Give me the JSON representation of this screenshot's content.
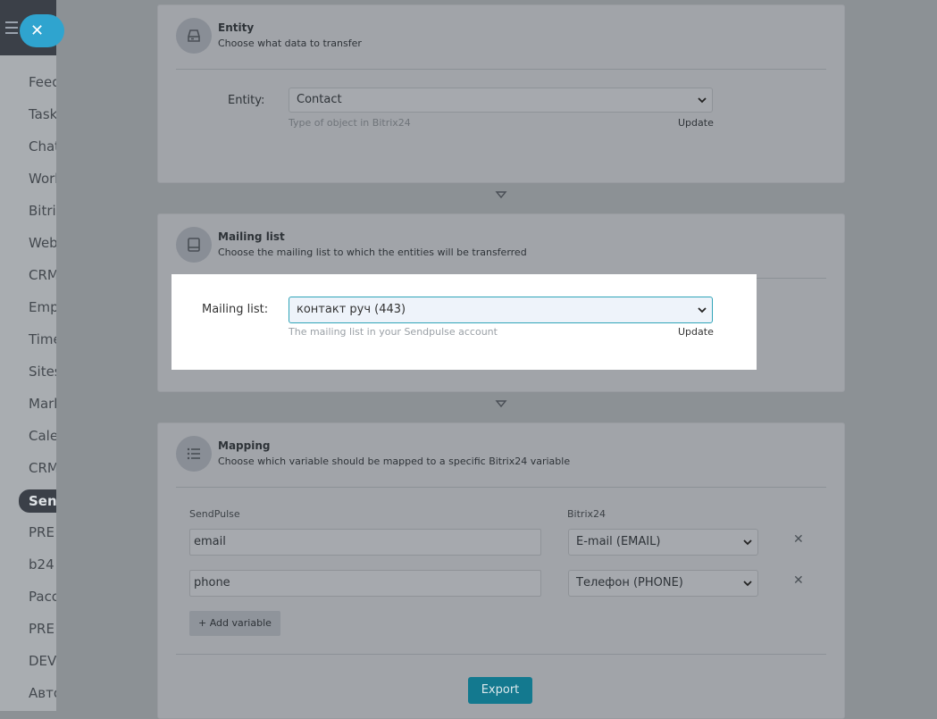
{
  "sidebar": {
    "items": [
      "Feed",
      "Tasks",
      "Chat",
      "Work",
      "Bitrix",
      "Web",
      "CRM",
      "Emp",
      "Time",
      "Sites",
      "Mark",
      "Cale",
      "CRM",
      "Send",
      "PRE",
      "b24",
      "Pacc",
      "PRE",
      "DEV",
      "Авто"
    ],
    "active_label": "Send"
  },
  "close_icon": "close-icon",
  "entity": {
    "title": "Entity",
    "subtitle": "Choose what data to transfer",
    "field_label": "Entity:",
    "value": "Contact",
    "hint": "Type of object in Bitrix24",
    "update": "Update"
  },
  "mailing": {
    "title": "Mailing list",
    "subtitle": "Choose the mailing list to which the entities will be transferred",
    "field_label": "Mailing list:",
    "value": "контакт руч (443)",
    "hint": "The mailing list in your Sendpulse account",
    "update": "Update"
  },
  "mapping": {
    "title": "Mapping",
    "subtitle": "Choose which variable should be mapped to a specific Bitrix24 variable",
    "col_left": "SendPulse",
    "col_right": "Bitrix24",
    "rows": [
      {
        "sendpulse": "email",
        "bitrix": "E-mail (EMAIL)"
      },
      {
        "sendpulse": "phone",
        "bitrix": "Телефон (PHONE)"
      }
    ],
    "add_variable": "Add variable",
    "export": "Export"
  },
  "colors": {
    "accent": "#2fa4cf",
    "export": "#13798f",
    "focus": "#2fa4b8"
  }
}
